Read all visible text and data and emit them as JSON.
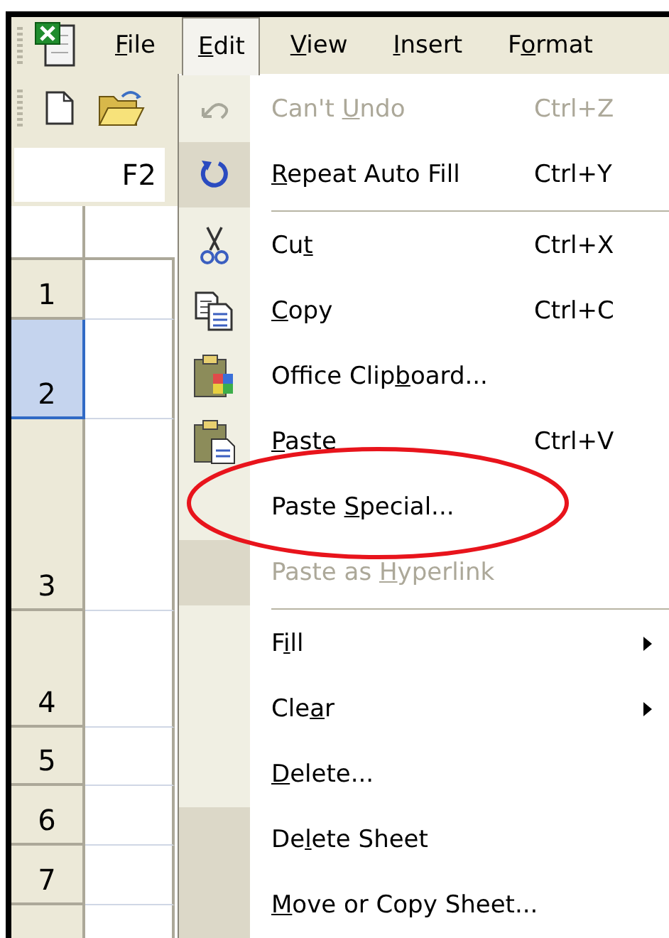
{
  "menu_bar": [
    {
      "key": "F",
      "post": "ile",
      "selected": false
    },
    {
      "key": "E",
      "post": "dit",
      "selected": true
    },
    {
      "key": "V",
      "post": "iew",
      "selected": false
    },
    {
      "key": "I",
      "post": "nsert",
      "selected": false
    },
    {
      "pre": "F",
      "key": "o",
      "post": "rmat",
      "selected": false
    }
  ],
  "name_box": {
    "value": "F2"
  },
  "row_headers": [
    {
      "label": "1",
      "selected": false
    },
    {
      "label": "2",
      "selected": true
    },
    {
      "label": "3",
      "selected": false
    },
    {
      "label": "4",
      "selected": false
    },
    {
      "label": "5",
      "selected": false
    },
    {
      "label": "6",
      "selected": false
    },
    {
      "label": "7",
      "selected": false
    }
  ],
  "edit_menu": [
    {
      "kind": "undo",
      "pre": "Can't ",
      "key": "U",
      "post": "ndo",
      "shortcut": "Ctrl+Z",
      "disabled": true,
      "rarely_used": false
    },
    {
      "kind": "redo",
      "key": "R",
      "post": "epeat Auto Fill",
      "shortcut": "Ctrl+Y",
      "disabled": false,
      "rarely_used": true
    },
    {
      "kind": "separator"
    },
    {
      "kind": "cut",
      "pre": "Cu",
      "key": "t",
      "shortcut": "Ctrl+X",
      "disabled": false,
      "rarely_used": false
    },
    {
      "kind": "copy",
      "key": "C",
      "post": "opy",
      "shortcut": "Ctrl+C",
      "disabled": false,
      "rarely_used": false
    },
    {
      "kind": "clipboard",
      "pre": "Office Clip",
      "key": "b",
      "post": "oard...",
      "disabled": false,
      "rarely_used": false
    },
    {
      "kind": "paste",
      "key": "P",
      "post": "aste",
      "shortcut": "Ctrl+V",
      "disabled": false,
      "rarely_used": false
    },
    {
      "kind": "plain",
      "pre": "Paste ",
      "key": "S",
      "post": "pecial...",
      "disabled": false,
      "rarely_used": false,
      "circled": true
    },
    {
      "kind": "plain",
      "pre": "Paste as ",
      "key": "H",
      "post": "yperlink",
      "disabled": true,
      "rarely_used": true
    },
    {
      "kind": "separator"
    },
    {
      "kind": "submenu",
      "pre": "F",
      "key": "i",
      "post": "ll",
      "disabled": false,
      "rarely_used": false
    },
    {
      "kind": "submenu",
      "pre": "Cle",
      "key": "a",
      "post": "r",
      "disabled": false,
      "rarely_used": false
    },
    {
      "kind": "plain",
      "key": "D",
      "post": "elete...",
      "disabled": false,
      "rarely_used": false
    },
    {
      "kind": "plain",
      "pre": "De",
      "key": "l",
      "post": "ete Sheet",
      "disabled": false,
      "rarely_used": true
    },
    {
      "kind": "plain",
      "key": "M",
      "post": "ove or Copy Sheet...",
      "disabled": false,
      "rarely_used": true
    }
  ]
}
